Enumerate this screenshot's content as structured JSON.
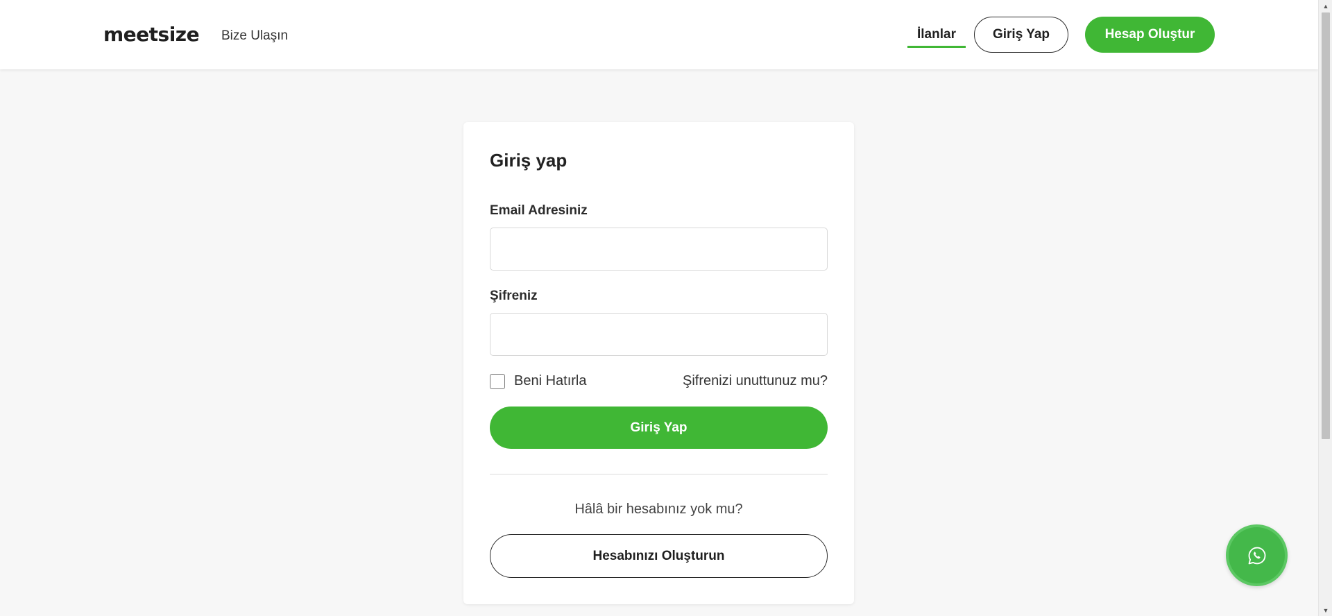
{
  "header": {
    "logo": "meetsize",
    "contact_link": "Bize Ulaşın",
    "nav_listings": "İlanlar",
    "nav_login": "Giriş Yap",
    "nav_register": "Hesap Oluştur"
  },
  "login_form": {
    "title": "Giriş yap",
    "email_label": "Email Adresiniz",
    "email_value": "",
    "password_label": "Şifreniz",
    "password_value": "",
    "remember_me_label": "Beni Hatırla",
    "remember_me_checked": false,
    "forgot_password_link": "Şifrenizi unuttunuz mu?",
    "submit_label": "Giriş Yap",
    "no_account_text": "Hâlâ bir hesabınız yok mu?",
    "create_account_label": "Hesabınızı Oluşturun"
  },
  "floating": {
    "icon": "whatsapp-icon"
  },
  "colors": {
    "accent": "#40b735",
    "background": "#f7f7f7",
    "card": "#ffffff",
    "text": "#222222"
  }
}
